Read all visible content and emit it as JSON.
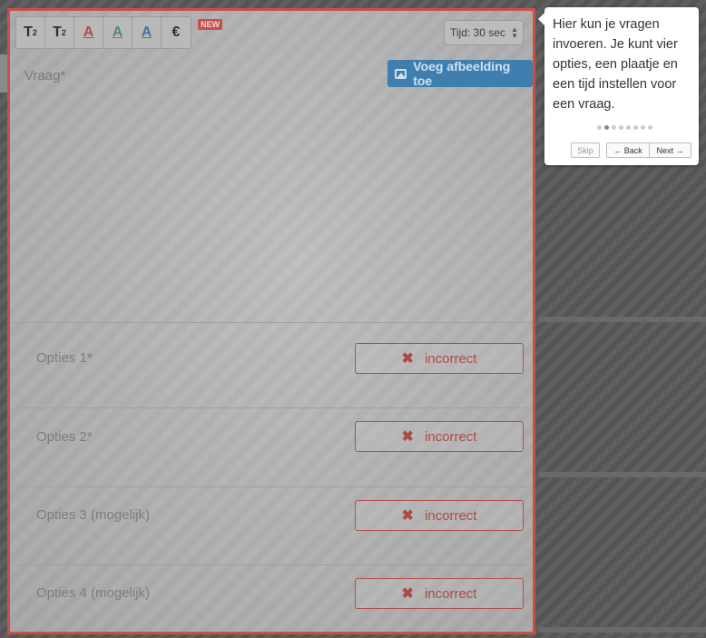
{
  "toolbar": {
    "superscript_label": "T",
    "superscript_mark": "2",
    "subscript_label": "T",
    "subscript_mark": "2",
    "color_red_label": "A",
    "color_green_label": "A",
    "color_blue_label": "A",
    "euro_label": "€",
    "new_badge": "NEW"
  },
  "time_select": {
    "value": "Tijd: 30 sec"
  },
  "add_image_label": "Voeg afbeelding toe",
  "question_label": "Vraag*",
  "options": [
    {
      "label": "Opties 1*",
      "status": "incorrect"
    },
    {
      "label": "Opties 2*",
      "status": "incorrect"
    },
    {
      "label": "Opties 3 (mogelijk)",
      "status": "incorrect"
    },
    {
      "label": "Opties 4 (mogelijk)",
      "status": "incorrect"
    }
  ],
  "tour": {
    "text": "Hier kun je vragen invoeren. Je kunt vier opties, een plaatje en een tijd instellen voor een vraag.",
    "current_step": 2,
    "total_steps": 8,
    "skip_label": "Skip",
    "back_label": "← Back",
    "next_label": "Next →"
  },
  "colors": {
    "highlight_border": "#c9504a",
    "accent_blue": "#3e7fb0",
    "incorrect_red": "#ad4a45"
  }
}
